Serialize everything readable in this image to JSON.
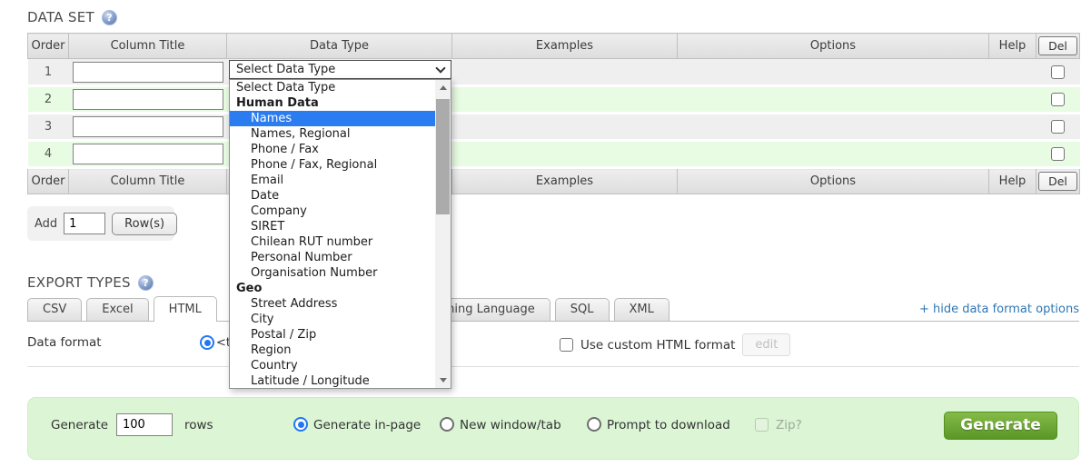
{
  "dataset": {
    "title": "DATA SET",
    "headers": {
      "order": "Order",
      "column_title": "Column Title",
      "data_type": "Data Type",
      "examples": "Examples",
      "options": "Options",
      "help": "Help",
      "del": "Del"
    },
    "rows": [
      {
        "order": "1",
        "column_title_value": ""
      },
      {
        "order": "2",
        "column_title_value": ""
      },
      {
        "order": "3",
        "column_title_value": ""
      },
      {
        "order": "4",
        "column_title_value": ""
      }
    ],
    "add_row": {
      "label": "Add",
      "count_value": "1",
      "button": "Row(s)"
    }
  },
  "dropdown": {
    "selected": "Select Data Type",
    "items": [
      {
        "label": "Select Data Type",
        "type": "option-root"
      },
      {
        "label": "Human Data",
        "type": "group"
      },
      {
        "label": "Names",
        "type": "option",
        "highlighted": true
      },
      {
        "label": "Names, Regional",
        "type": "option"
      },
      {
        "label": "Phone / Fax",
        "type": "option"
      },
      {
        "label": "Phone / Fax, Regional",
        "type": "option"
      },
      {
        "label": "Email",
        "type": "option"
      },
      {
        "label": "Date",
        "type": "option"
      },
      {
        "label": "Company",
        "type": "option"
      },
      {
        "label": "SIRET",
        "type": "option"
      },
      {
        "label": "Chilean RUT number",
        "type": "option"
      },
      {
        "label": "Personal Number",
        "type": "option"
      },
      {
        "label": "Organisation Number",
        "type": "option"
      },
      {
        "label": "Geo",
        "type": "group"
      },
      {
        "label": "Street Address",
        "type": "option"
      },
      {
        "label": "City",
        "type": "option"
      },
      {
        "label": "Postal / Zip",
        "type": "option"
      },
      {
        "label": "Region",
        "type": "option"
      },
      {
        "label": "Country",
        "type": "option"
      },
      {
        "label": "Latitude / Longitude",
        "type": "option"
      }
    ]
  },
  "export": {
    "title": "EXPORT TYPES",
    "tabs": [
      "CSV",
      "Excel",
      "HTML",
      "Programming Language",
      "SQL",
      "XML"
    ],
    "active_tab": "HTML",
    "hide_link": "+ hide data format options",
    "html_panel": {
      "data_format_label": "Data format",
      "format_value_partial": "<t",
      "custom_checkbox_label": "Use custom HTML format",
      "edit_button": "edit"
    }
  },
  "generate": {
    "label": "Generate",
    "rows_value": "100",
    "rows_label": "rows",
    "radio_in_page": "Generate in-page",
    "radio_new_window": "New window/tab",
    "radio_prompt": "Prompt to download",
    "zip_label": "Zip?",
    "button": "Generate",
    "selected_radio": "Generate in-page"
  },
  "icons": {
    "help_glyph": "?"
  },
  "colors": {
    "row_gray": "#efefef",
    "row_green": "#e8fbe3",
    "header_bg": "#e4e4e4",
    "selection_blue": "#2b7cf0",
    "link_blue": "#2e77b5",
    "accent_radio": "#2176f5",
    "bar_bg": "#dbf5d5",
    "button_green": "#5a9727",
    "help_icon_blue": "#8aa3cf"
  }
}
